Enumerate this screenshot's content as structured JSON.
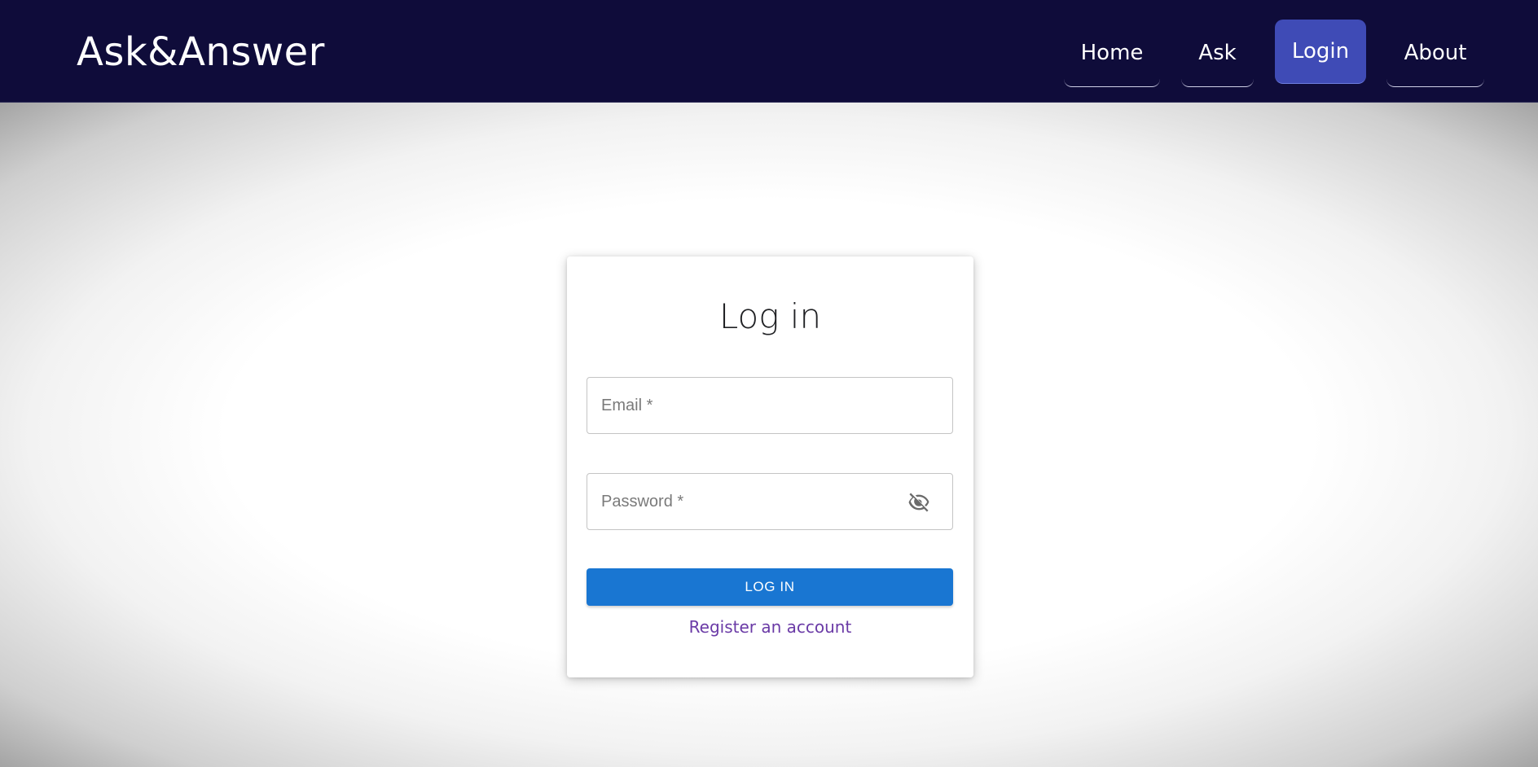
{
  "header": {
    "brand": "Ask&Answer",
    "nav": [
      {
        "label": "Home",
        "active": false
      },
      {
        "label": "Ask",
        "active": false
      },
      {
        "label": "Login",
        "active": true
      },
      {
        "label": "About",
        "active": false
      }
    ],
    "colors": {
      "background": "#0f0c3a",
      "active_item": "#3f4bb6"
    }
  },
  "login": {
    "title": "Log in",
    "email": {
      "placeholder": "Email *",
      "value": ""
    },
    "password": {
      "placeholder": "Password *",
      "value": "",
      "toggle_icon": "eye-off-icon"
    },
    "submit_label": "LOG IN",
    "register_link": "Register an account",
    "colors": {
      "button": "#1976d2",
      "link": "#6a3aa6"
    }
  }
}
